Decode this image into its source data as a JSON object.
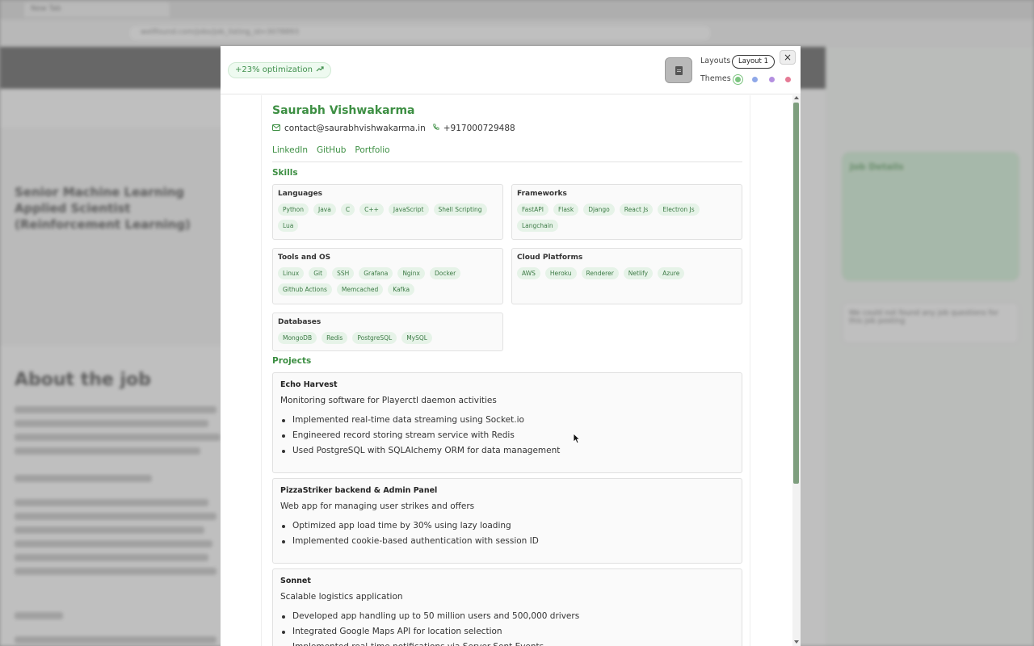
{
  "header": {
    "optimization_badge": "+23% optimization",
    "layouts_label": "Layouts",
    "layout_selected": "Layout 1",
    "themes_label": "Themes",
    "theme_colors": [
      "#7bc47f",
      "#8fa8e8",
      "#b48fe0",
      "#e57a95"
    ],
    "close_symbol": "×"
  },
  "resume": {
    "name": "Saurabh Vishwakarma",
    "email": "contact@saurabhvishwakarma.in",
    "phone": "+917000729488",
    "links": [
      "LinkedIn",
      "GitHub",
      "Portfolio"
    ],
    "skills_heading": "Skills",
    "skills": {
      "languages": {
        "title": "Languages",
        "items": [
          "Python",
          "Java",
          "C",
          "C++",
          "JavaScript",
          "Shell Scripting",
          "Lua"
        ]
      },
      "frameworks": {
        "title": "Frameworks",
        "items": [
          "FastAPI",
          "Flask",
          "Django",
          "React Js",
          "Electron Js",
          "Langchain"
        ]
      },
      "tools": {
        "title": "Tools and OS",
        "items": [
          "Linux",
          "Git",
          "SSH",
          "Grafana",
          "Nginx",
          "Docker",
          "Github Actions",
          "Memcached",
          "Kafka"
        ]
      },
      "cloud": {
        "title": "Cloud Platforms",
        "items": [
          "AWS",
          "Heroku",
          "Renderer",
          "Netlify",
          "Azure"
        ]
      },
      "databases": {
        "title": "Databases",
        "items": [
          "MongoDB",
          "Redis",
          "PostgreSQL",
          "MySQL"
        ]
      }
    },
    "projects_heading": "Projects",
    "projects": [
      {
        "title": "Echo Harvest",
        "description": "Monitoring software for Playerctl daemon activities",
        "bullets": [
          "Implemented real-time data streaming using Socket.io",
          "Engineered record storing stream service with Redis",
          "Used PostgreSQL with SQLAlchemy ORM for data management"
        ]
      },
      {
        "title": "PizzaStriker backend & Admin Panel",
        "description": "Web app for managing user strikes and offers",
        "bullets": [
          "Optimized app load time by 30% using lazy loading",
          "Implemented cookie-based authentication with session ID"
        ]
      },
      {
        "title": "Sonnet",
        "description": "Scalable logistics application",
        "bullets": [
          "Developed app handling up to 50 million users and 500,000 drivers",
          "Integrated Google Maps API for location selection",
          "Implemented real-time notifications via Server-Sent Events"
        ]
      }
    ]
  },
  "background": {
    "tab_title": "New Tab",
    "url": "wellfound.com/jobs/job_listing_id=3078893",
    "job_title": "Senior Machine Learning Applied Scientist (Reinforcement Learning)",
    "about_heading": "About the job",
    "side_card_title": "Job Details",
    "side_question_text": "We could not found any job questions for this job posting"
  }
}
